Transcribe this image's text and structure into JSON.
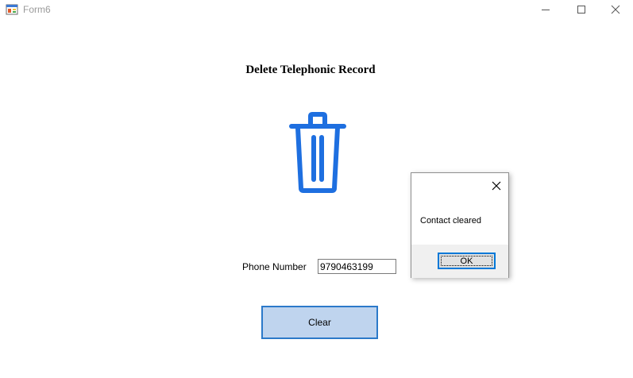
{
  "window": {
    "title": "Form6",
    "controls": {
      "minimize_icon": "minimize-icon",
      "maximize_icon": "maximize-icon",
      "close_icon": "close-icon"
    }
  },
  "main": {
    "heading": "Delete Telephonic Record",
    "trash_icon": "trash-icon",
    "trash_color": "#1e6fe0",
    "phone_label": "Phone Number",
    "phone_value": "9790463199",
    "clear_button_label": "Clear"
  },
  "message_box": {
    "message": "Contact cleared",
    "ok_label": "OK",
    "close_icon": "close-icon"
  },
  "colors": {
    "accent_border": "#2b79c9",
    "button_fill": "#bfd4ee"
  }
}
